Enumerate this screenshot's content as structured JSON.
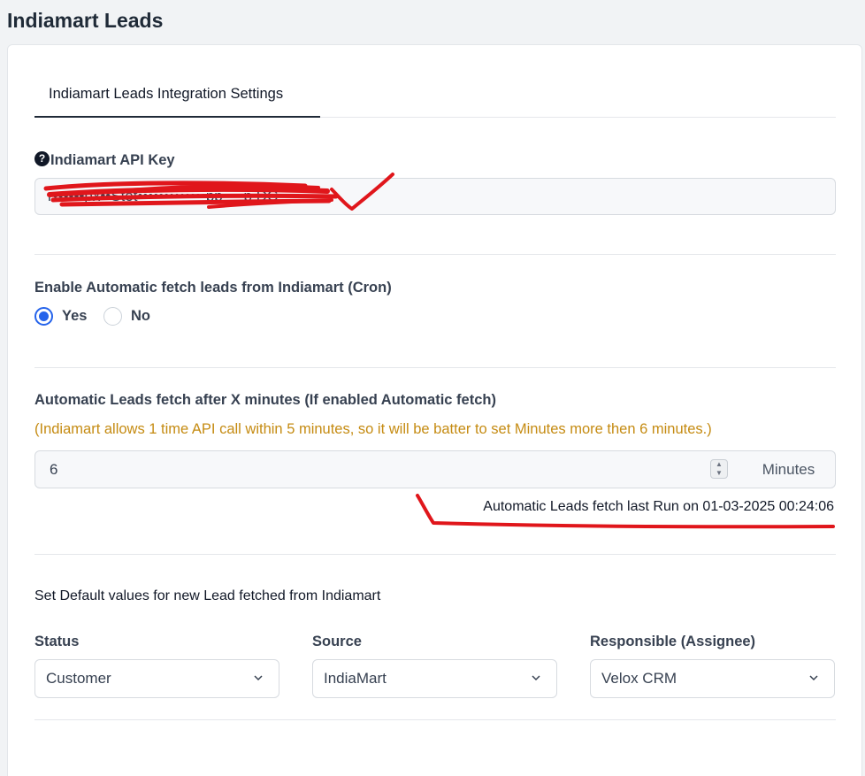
{
  "page": {
    "title": "Indiamart Leads"
  },
  "tabs": [
    {
      "label": "Indiamart Leads Integration Settings",
      "active": true
    }
  ],
  "api_key": {
    "label": "Indiamart API Key",
    "help_icon": "question-circle-icon",
    "value": "r••••••px••Stet•••••••••••••pp••••p DC"
  },
  "cron": {
    "label": "Enable Automatic fetch leads from Indiamart (Cron)",
    "options": [
      {
        "label": "Yes",
        "checked": true
      },
      {
        "label": "No",
        "checked": false
      }
    ]
  },
  "interval": {
    "label": "Automatic Leads fetch after X minutes (If enabled Automatic fetch)",
    "note": "(Indiamart allows 1 time API call within 5 minutes, so it will be batter to set Minutes more then 6 minutes.)",
    "value": "6",
    "unit": "Minutes",
    "last_run": "Automatic Leads fetch last Run on 01-03-2025 00:24:06"
  },
  "defaults": {
    "heading": "Set Default values for new Lead fetched from Indiamart",
    "status": {
      "label": "Status",
      "value": "Customer"
    },
    "source": {
      "label": "Source",
      "value": "IndiaMart"
    },
    "responsible": {
      "label": "Responsible (Assignee)",
      "value": "Velox CRM"
    }
  },
  "colors": {
    "accent": "#2563eb",
    "note": "#c58b12",
    "annotation": "#e0161b"
  }
}
